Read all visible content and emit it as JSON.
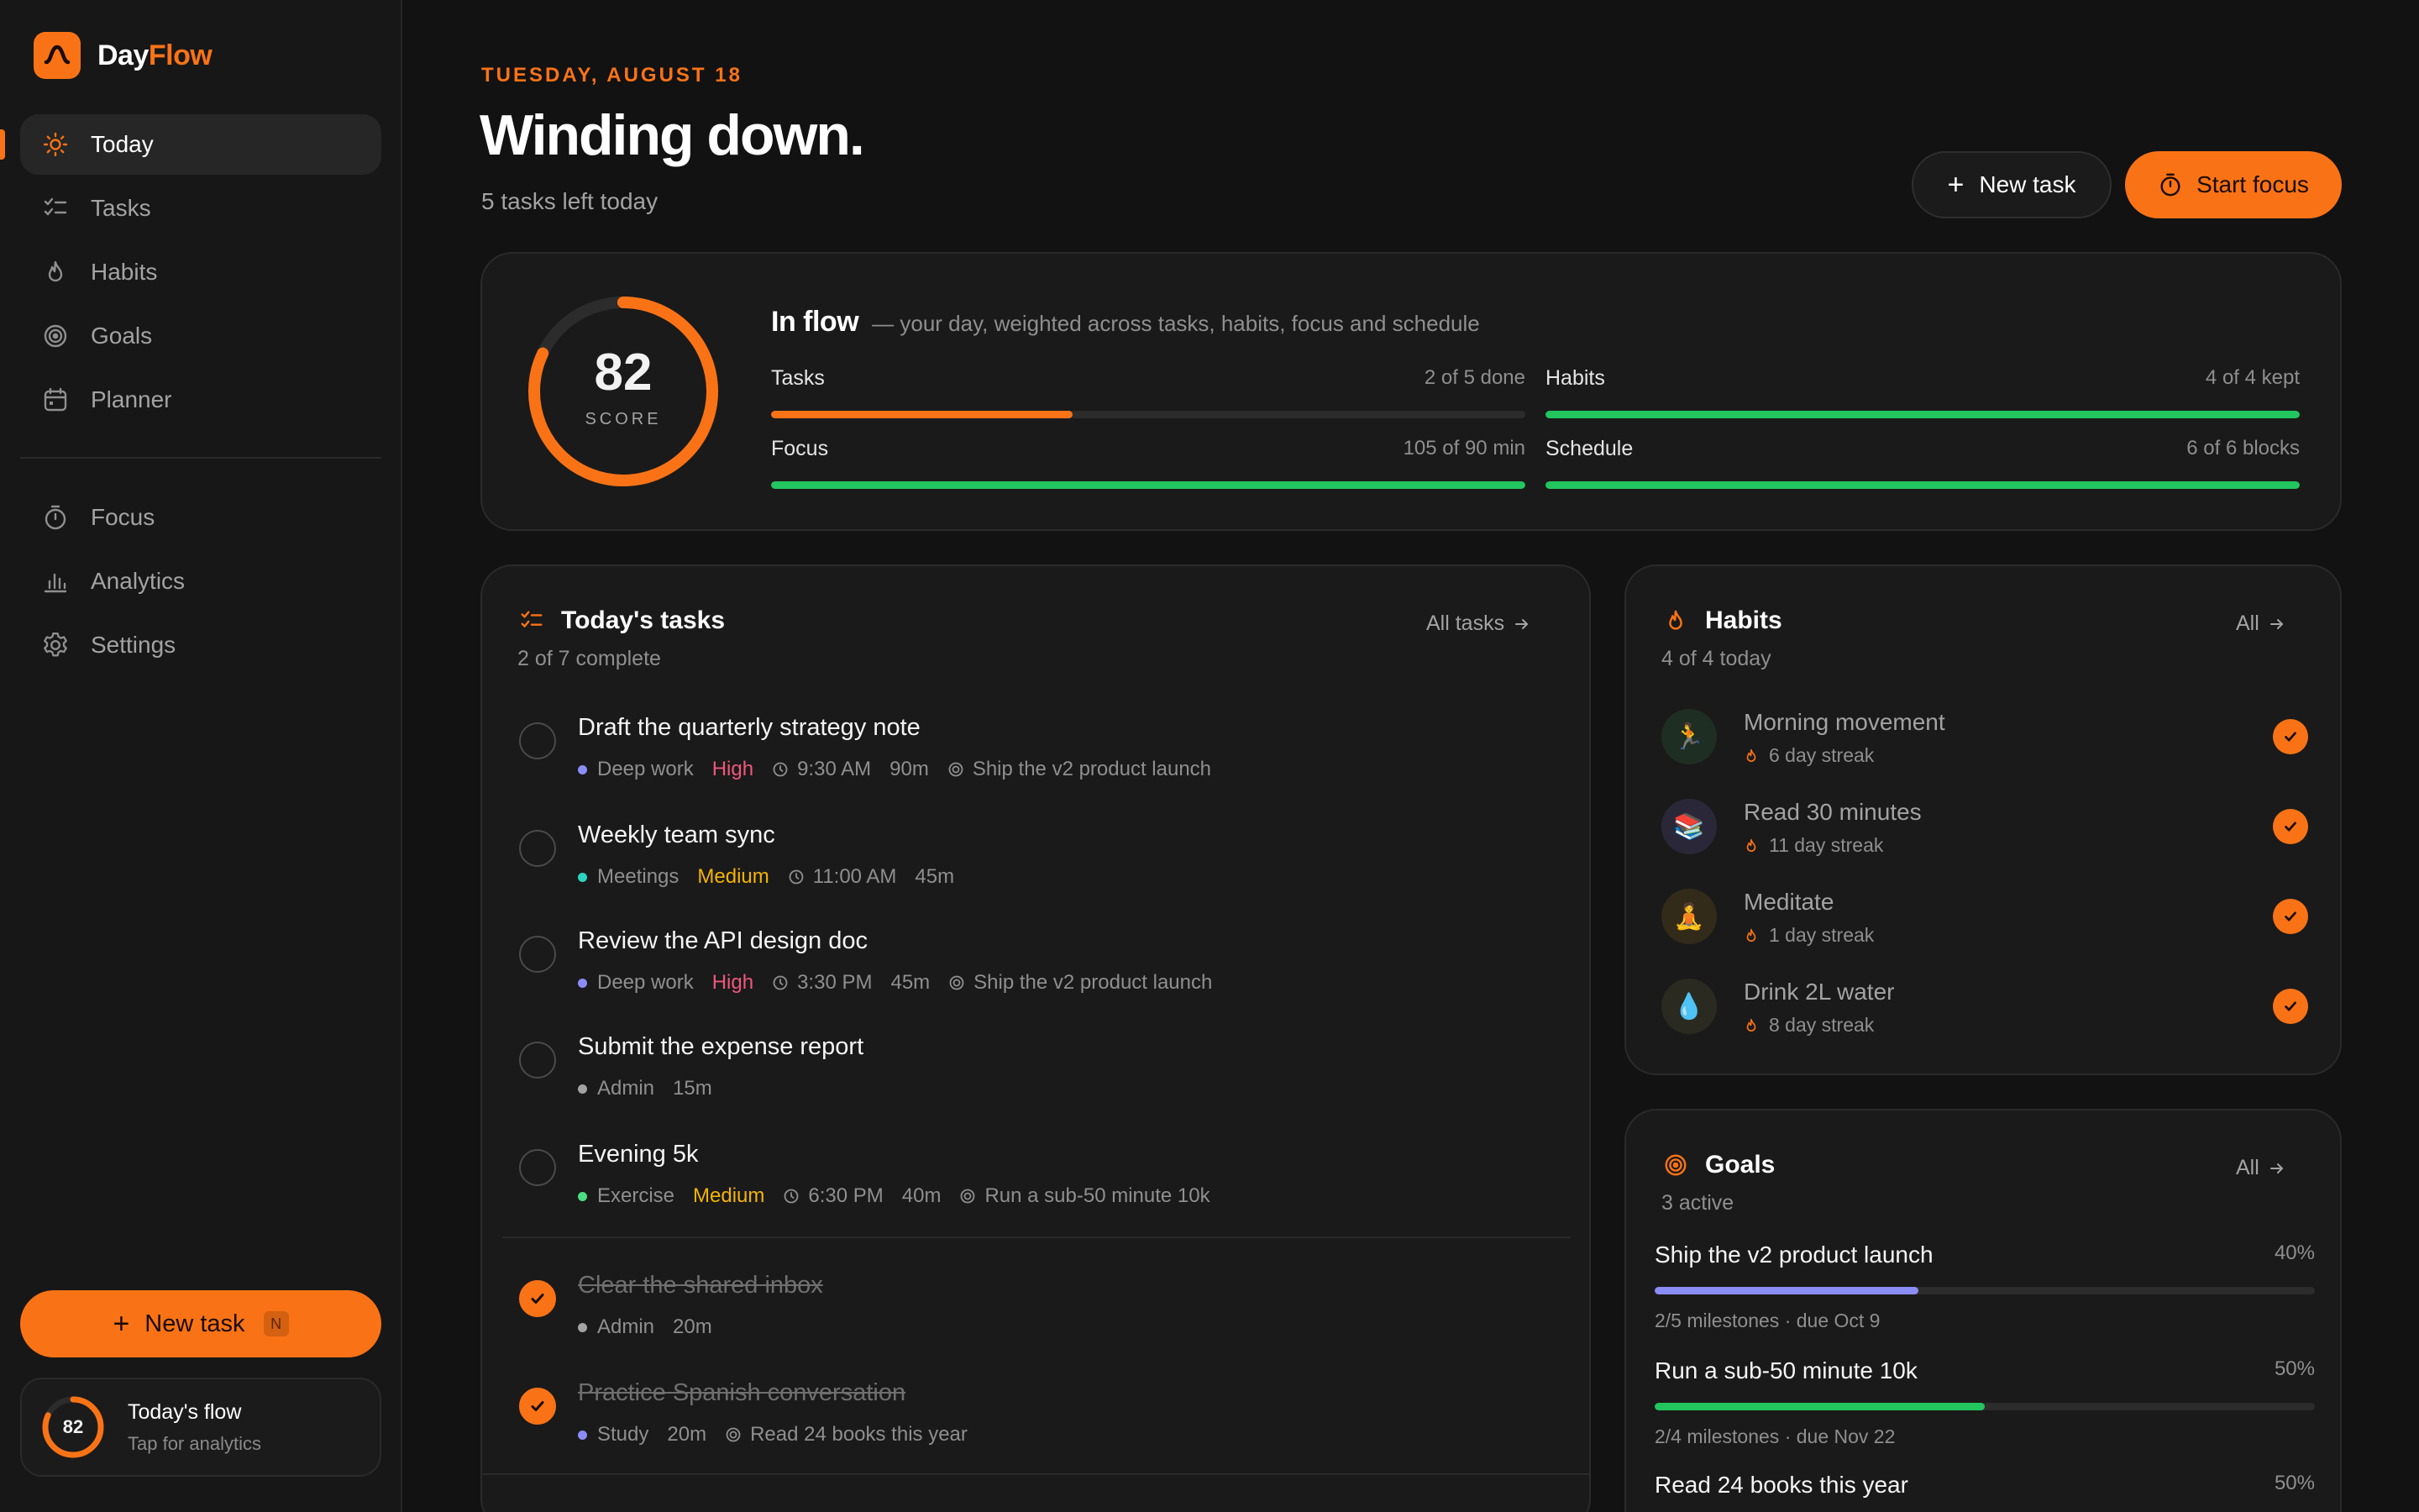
{
  "app": {
    "name_part1": "Day",
    "name_part2": "Flow",
    "brand_color": "#f97316"
  },
  "sidebar": {
    "nav": [
      {
        "label": "Today",
        "icon": "sun-icon",
        "active": true
      },
      {
        "label": "Tasks",
        "icon": "checklist-icon"
      },
      {
        "label": "Habits",
        "icon": "flame-icon"
      },
      {
        "label": "Goals",
        "icon": "target-icon"
      },
      {
        "label": "Planner",
        "icon": "calendar-icon"
      }
    ],
    "nav2": [
      {
        "label": "Focus",
        "icon": "timer-icon"
      },
      {
        "label": "Analytics",
        "icon": "bar-chart-icon"
      },
      {
        "label": "Settings",
        "icon": "gear-icon"
      }
    ],
    "new_task_label": "New task",
    "new_task_shortcut": "N",
    "flow": {
      "score": "82",
      "score_fraction": 0.82,
      "title": "Today's flow",
      "subtitle": "Tap for analytics"
    }
  },
  "header": {
    "date": "TUESDAY, AUGUST 18",
    "title": "Winding down.",
    "subtitle": "5 tasks left today",
    "new_task_button": "New task",
    "start_focus_button": "Start focus"
  },
  "score": {
    "value": "82",
    "value_fraction": 0.82,
    "label": "SCORE",
    "heading": "In flow",
    "description": "— your day, weighted across tasks, habits, focus and schedule",
    "metrics": [
      {
        "name": "Tasks",
        "value": "2 of 5 done",
        "fraction": 0.4,
        "color": "#f97316"
      },
      {
        "name": "Habits",
        "value": "4 of 4 kept",
        "fraction": 1.0,
        "color": "#22c55e"
      },
      {
        "name": "Focus",
        "value": "105 of 90 min",
        "fraction": 1.0,
        "color": "#22c55e"
      },
      {
        "name": "Schedule",
        "value": "6 of 6 blocks",
        "fraction": 1.0,
        "color": "#22c55e"
      }
    ]
  },
  "tasks": {
    "title": "Today's tasks",
    "subtitle": "2 of 7 complete",
    "link": "All tasks",
    "items": [
      {
        "title": "Draft the quarterly strategy note",
        "category": "Deep work",
        "category_color": "#8b8cf5",
        "priority": "High",
        "time": "9:30 AM",
        "duration": "90m",
        "goal": "Ship the v2 product launch",
        "done": false
      },
      {
        "title": "Weekly team sync",
        "category": "Meetings",
        "category_color": "#2dd4bf",
        "priority": "Medium",
        "time": "11:00 AM",
        "duration": "45m",
        "goal": "",
        "done": false
      },
      {
        "title": "Review the API design doc",
        "category": "Deep work",
        "category_color": "#8b8cf5",
        "priority": "High",
        "time": "3:30 PM",
        "duration": "45m",
        "goal": "Ship the v2 product launch",
        "done": false
      },
      {
        "title": "Submit the expense report",
        "category": "Admin",
        "category_color": "#a3a3a3",
        "priority": "",
        "time": "",
        "duration": "15m",
        "goal": "",
        "done": false
      },
      {
        "title": "Evening 5k",
        "category": "Exercise",
        "category_color": "#4ade80",
        "priority": "Medium",
        "time": "6:30 PM",
        "duration": "40m",
        "goal": "Run a sub-50 minute 10k",
        "done": false
      },
      {
        "title": "Clear the shared inbox",
        "category": "Admin",
        "category_color": "#a3a3a3",
        "priority": "",
        "time": "",
        "duration": "20m",
        "goal": "",
        "done": true
      },
      {
        "title": "Practice Spanish conversation",
        "category": "Study",
        "category_color": "#8b8cf5",
        "priority": "",
        "time": "",
        "duration": "20m",
        "goal": "Read 24 books this year",
        "done": true
      }
    ]
  },
  "habits": {
    "title": "Habits",
    "subtitle": "4 of 4 today",
    "link": "All",
    "items": [
      {
        "name": "Morning movement",
        "streak": "6 day streak",
        "emoji": "🏃",
        "bg": "#1f2e22"
      },
      {
        "name": "Read 30 minutes",
        "streak": "11 day streak",
        "emoji": "📚",
        "bg": "#2a2838"
      },
      {
        "name": "Meditate",
        "streak": "1 day streak",
        "emoji": "🧘",
        "bg": "#332b1a"
      },
      {
        "name": "Drink 2L water",
        "streak": "8 day streak",
        "emoji": "💧",
        "bg": "#2a2a20"
      }
    ]
  },
  "goals": {
    "title": "Goals",
    "subtitle": "3 active",
    "link": "All",
    "items": [
      {
        "name": "Ship the v2 product launch",
        "pct": "40%",
        "fraction": 0.4,
        "color": "#8b8cf5",
        "sub": "2/5 milestones · due Oct 9"
      },
      {
        "name": "Run a sub-50 minute 10k",
        "pct": "50%",
        "fraction": 0.5,
        "color": "#22c55e",
        "sub": "2/4 milestones · due Nov 22"
      },
      {
        "name": "Read 24 books this year",
        "pct": "50%",
        "fraction": 0.5,
        "color": "#f97316",
        "sub": ""
      }
    ]
  }
}
